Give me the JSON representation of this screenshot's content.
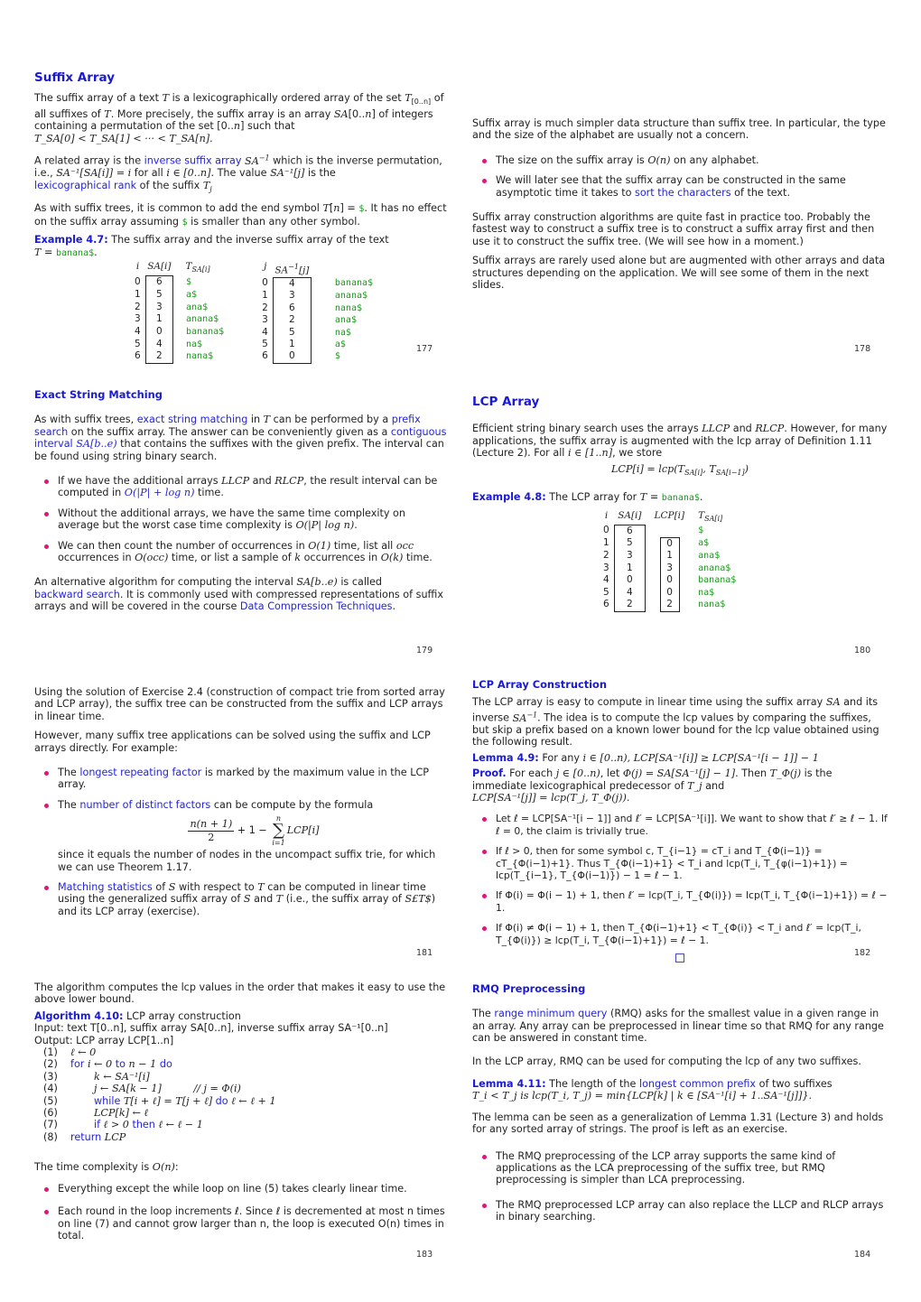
{
  "slides": {
    "s177": {
      "title": "Suffix Array",
      "p1": [
        "The suffix array of a text ",
        "T",
        " is a lexicographically ordered array of the set ",
        "T",
        "[0..n]",
        " of all suffixes of ",
        "T",
        ". More precisely, the suffix array is an array ",
        "SA",
        "[0..",
        "n",
        "]",
        " of integers containing a permutation of the set [0..",
        "n",
        "] such that"
      ],
      "p1_formula": "T_SA[0] < T_SA[1] < ··· < T_SA[n].",
      "p2_pre": "A related array is the ",
      "p2_link": "inverse suffix array",
      "p2_mid": " which is the inverse permutation, i.e., ",
      "p2_formula1": "SA⁻¹[SA[i]] = i",
      "p2_mid2": " for all ",
      "p2_formula2": "i ∈ [0..n]",
      "p2_mid3": ". The value ",
      "p2_formula3": "SA⁻¹[j]",
      "p2_mid4": " is the ",
      "p2_link2": "lexicographical rank",
      "p2_end": " of the suffix ",
      "p3_a": "As with suffix trees, it is common to add the end symbol ",
      "p3_b": ". It has no effect on the suffix array assuming ",
      "p3_c": " is smaller than any other symbol.",
      "dollar": "$",
      "example_label": "Example 4.7:",
      "example_text": " The suffix array and the inverse suffix array of the text",
      "text_value": "banana$",
      "table1_headers": [
        "i",
        "SA[i]",
        "T_SA[i]"
      ],
      "table2_headers": [
        "j",
        "SA⁻¹[j]"
      ],
      "rows": [
        {
          "i": "0",
          "sa": "6",
          "suf": "$",
          "j": "0",
          "isa": "4",
          "suf2": "banana$"
        },
        {
          "i": "1",
          "sa": "5",
          "suf": "a$",
          "j": "1",
          "isa": "3",
          "suf2": "anana$"
        },
        {
          "i": "2",
          "sa": "3",
          "suf": "ana$",
          "j": "2",
          "isa": "6",
          "suf2": "nana$"
        },
        {
          "i": "3",
          "sa": "1",
          "suf": "anana$",
          "j": "3",
          "isa": "2",
          "suf2": "ana$"
        },
        {
          "i": "4",
          "sa": "0",
          "suf": "banana$",
          "j": "4",
          "isa": "5",
          "suf2": "na$"
        },
        {
          "i": "5",
          "sa": "4",
          "suf": "na$",
          "j": "5",
          "isa": "1",
          "suf2": "a$"
        },
        {
          "i": "6",
          "sa": "2",
          "suf": "nana$",
          "j": "6",
          "isa": "0",
          "suf2": "$"
        }
      ],
      "page": "177"
    },
    "s178": {
      "p1": "Suffix array is much simpler data structure than suffix tree. In particular, the type and the size of the alphabet are usually not a concern.",
      "b1_pre": "The size on the suffix array is ",
      "b1_math": "O(n)",
      "b1_post": " on any alphabet.",
      "b2_pre": "We will later see that the suffix array can be constructed in the same asymptotic time it takes to ",
      "b2_link": "sort the characters",
      "b2_post": " of the text.",
      "p2": "Suffix array construction algorithms are quite fast in practice too. Probably the fastest way to construct a suffix tree is to construct a suffix array first and then use it to construct the suffix tree. (We will see how in a moment.)",
      "p3": "Suffix arrays are rarely used alone but are augmented with other arrays and data structures depending on the application. We will see some of them in the next slides.",
      "page": "178"
    },
    "s179": {
      "title": "Exact String Matching",
      "p1_a": "As with suffix trees, ",
      "p1_link1": "exact string matching",
      "p1_b": " in ",
      "p1_c": " can be performed by a ",
      "p1_link2": "prefix search",
      "p1_d": " on the suffix array. The answer can be conveniently given as a ",
      "p1_link3": "contiguous interval",
      "p1_e": " that contains the suffixes with the given prefix. The interval can be found using string binary search.",
      "interval": "SA[b..e)",
      "b1_pre": "If we have the additional arrays ",
      "b1_mid": " and ",
      "b1_mid2": ", the result interval can be computed in ",
      "b1_math": "O(|P| + log n)",
      "b1_post": " time.",
      "llcp": "LLCP",
      "rlcp": "RLCP",
      "b2_pre": "Without the additional arrays, we have the same time complexity on average but the worst case time complexity is ",
      "b2_math": "O(|P| log n)",
      "b2_post": ".",
      "b3": [
        "We can then count the number of occurrences in ",
        "O(1)",
        " time, list all ",
        "occ",
        " occurrences in ",
        "O(occ)",
        " time, or list a sample of ",
        "k",
        " occurrences in ",
        "O(k)",
        " time."
      ],
      "p2_a": "An alternative algorithm for computing the interval ",
      "p2_b": " is called ",
      "p2_link1": "backward search",
      "p2_c": ". It is commonly used with compressed representations of suffix arrays and will be covered in the course ",
      "p2_link2": "Data Compression Techniques",
      "p2_d": ".",
      "page": "179"
    },
    "s180": {
      "title": "LCP Array",
      "p1_a": "Efficient string binary search uses the arrays ",
      "p1_b": " and ",
      "p1_c": ". However, for many applications, the suffix array is augmented with the lcp array of Definition 1.11 (Lecture 2). For all ",
      "p1_math": "i ∈ [1..n]",
      "p1_d": ", we store",
      "formula": "LCP[i] = lcp(T_SA[i], T_SA[i−1])",
      "example_label": "Example 4.8:",
      "example_text": " The LCP array for ",
      "text_value": "banana$",
      "headers": [
        "i",
        "SA[i]",
        "LCP[i]",
        "T_SA[i]"
      ],
      "rows": [
        {
          "i": "0",
          "sa": "6",
          "lcp": "",
          "suf": "$"
        },
        {
          "i": "1",
          "sa": "5",
          "lcp": "0",
          "suf": "a$"
        },
        {
          "i": "2",
          "sa": "3",
          "lcp": "1",
          "suf": "ana$"
        },
        {
          "i": "3",
          "sa": "1",
          "lcp": "3",
          "suf": "anana$"
        },
        {
          "i": "4",
          "sa": "0",
          "lcp": "0",
          "suf": "banana$"
        },
        {
          "i": "5",
          "sa": "4",
          "lcp": "0",
          "suf": "na$"
        },
        {
          "i": "6",
          "sa": "2",
          "lcp": "2",
          "suf": "nana$"
        }
      ],
      "page": "180"
    },
    "s181": {
      "p1": "Using the solution of Exercise 2.4 (construction of compact trie from sorted array and LCP array), the suffix tree can be constructed from the suffix and LCP arrays in linear time.",
      "p2": "However, many suffix tree applications can be solved using the suffix and LCP arrays directly. For example:",
      "b1_pre": "The ",
      "b1_link": "longest repeating factor",
      "b1_post": " is marked by the maximum value in the LCP array.",
      "b2_pre": "The ",
      "b2_link": "number of distinct factors",
      "b2_post": " can be compute by the formula",
      "formula_num": "n(n + 1)",
      "formula_den": "2",
      "formula_mid": "+ 1 −",
      "sum_top": "n",
      "sum_bot": "i=1",
      "formula_end": "LCP[i]",
      "b2_cont": "since it equals the number of nodes in the uncompact suffix trie, for which we can use Theorem 1.17.",
      "b3_link": "Matching statistics",
      "b3_a": " of ",
      "b3_b": " with respect to ",
      "b3_c": " can be computed in linear time using the generalized suffix array of ",
      "b3_d": " and ",
      "b3_e": " (i.e., the suffix array of ",
      "b3_f": ") and its LCP array (exercise).",
      "S": "S",
      "T": "T",
      "SLT": "S£T$",
      "page": "181"
    },
    "s182": {
      "title": "LCP Array Construction",
      "p1_a": "The LCP array is easy to compute in linear time using the suffix array ",
      "p1_b": " and its inverse ",
      "p1_c": ". The idea is to compute the lcp values by comparing the suffixes, but skip a prefix based on a known lower bound for the lcp value obtained using the following result.",
      "lemma_label": "Lemma 4.9:",
      "lemma_a": " For any ",
      "lemma_math": "i ∈ [0..n), LCP[SA⁻¹[i]] ≥ LCP[SA⁻¹[i − 1]] − 1",
      "proof_label": "Proof.",
      "proof_a": " For each ",
      "proof_m1": "j ∈ [0..n)",
      "proof_b": ", let ",
      "proof_m2": "Φ(j) = SA[SA⁻¹[j] − 1]",
      "proof_c": ". Then ",
      "proof_m3": "T_Φ(j)",
      "proof_d": " is the immediate lexicographical predecessor of ",
      "proof_m4": "T_j",
      "proof_e": " and ",
      "proof_m5": "LCP[SA⁻¹[j]] = lcp(T_j, T_Φ(j)).",
      "bullets": [
        "Let ℓ = LCP[SA⁻¹[i − 1]] and ℓ′ = LCP[SA⁻¹[i]]. We want to show that ℓ′ ≥ ℓ − 1. If ℓ = 0, the claim is trivially true.",
        "If ℓ > 0, then for some symbol c, T_{i−1} = cT_i and T_{Φ(i−1)} = cT_{Φ(i−1)+1}. Thus T_{Φ(i−1)+1} < T_i and lcp(T_i, T_{φ(i−1)+1}) = lcp(T_{i−1}, T_{Φ(i−1)}) − 1 = ℓ − 1.",
        "If Φ(i) = Φ(i − 1) + 1, then ℓ′ = lcp(T_i, T_{Φ(i)}) = lcp(T_i, T_{Φ(i−1)+1}) = ℓ − 1.",
        "If Φ(i) ≠ Φ(i − 1) + 1, then T_{Φ(i−1)+1} < T_{Φ(i)} < T_i and ℓ′ = lcp(T_i, T_{Φ(i)}) ≥ lcp(T_i, T_{Φ(i−1)+1}) = ℓ − 1."
      ],
      "page": "182"
    },
    "s183": {
      "p1": "The algorithm computes the lcp values in the order that makes it easy to use the above lower bound.",
      "algo_label": "Algorithm 4.10:",
      "algo_title": " LCP array construction",
      "input": "Input: text T[0..n], suffix array SA[0..n], inverse suffix array SA⁻¹[0..n]",
      "output": "Output: LCP array LCP[1..n]",
      "lines": [
        {
          "n": "(1)",
          "indent": 0,
          "kw": "",
          "text": "ℓ ← 0",
          "kw2": "",
          "text2": ""
        },
        {
          "n": "(2)",
          "indent": 0,
          "kw": "for",
          "text": " i ← 0 ",
          "kw2": "to",
          "text2": " n − 1 ",
          "kw3": "do"
        },
        {
          "n": "(3)",
          "indent": 1,
          "kw": "",
          "text": "k ← SA⁻¹[i]",
          "kw2": "",
          "text2": ""
        },
        {
          "n": "(4)",
          "indent": 1,
          "kw": "",
          "text": "j ← SA[k − 1]          // j = Φ(i)",
          "kw2": "",
          "text2": ""
        },
        {
          "n": "(5)",
          "indent": 1,
          "kw": "while",
          "text": " T[i + ℓ] = T[j + ℓ] ",
          "kw2": "do",
          "text2": " ℓ ← ℓ + 1"
        },
        {
          "n": "(6)",
          "indent": 1,
          "kw": "",
          "text": "LCP[k] ← ℓ",
          "kw2": "",
          "text2": ""
        },
        {
          "n": "(7)",
          "indent": 1,
          "kw": "if",
          "text": " ℓ > 0 ",
          "kw2": "then",
          "text2": " ℓ ← ℓ − 1"
        },
        {
          "n": "(8)",
          "indent": 0,
          "kw": "return",
          "text": " LCP",
          "kw2": "",
          "text2": ""
        }
      ],
      "p2_a": "The time complexity is ",
      "p2_math": "O(n)",
      "p2_b": ":",
      "b1": "Everything except the while loop on line (5) takes clearly linear time.",
      "b2": "Each round in the loop increments ℓ. Since ℓ is decremented at most n times on line (7) and cannot grow larger than n, the loop is executed O(n) times in total.",
      "page": "183"
    },
    "s184": {
      "title": "RMQ Preprocessing",
      "p1_a": "The ",
      "p1_link": "range minimum query",
      "p1_b": " (RMQ) asks for the smallest value in a given range in an array. Any array can be preprocessed in linear time so that RMQ for any range can be answered in constant time.",
      "p2": "In the LCP array, RMQ can be used for computing the lcp of any two suffixes.",
      "lemma_label": "Lemma 4.11:",
      "lemma_a": " The length of the ",
      "lemma_link": "longest common prefix",
      "lemma_b": " of two suffixes ",
      "lemma_math": "T_i < T_j is lcp(T_i, T_j) = min{LCP[k] | k ∈ [SA⁻¹[i] + 1..SA⁻¹[j]]}.",
      "p3": "The lemma can be seen as a generalization of Lemma 1.31 (Lecture 3) and holds for any sorted array of strings. The proof is left as an exercise.",
      "b1": "The RMQ preprocessing of the LCP array supports the same kind of applications as the LCA preprocessing of the suffix tree, but RMQ preprocessing is simpler than LCA preprocessing.",
      "b2": "The RMQ preprocessed LCP array can also replace the LLCP and RLCP arrays in binary searching.",
      "page": "184"
    }
  }
}
